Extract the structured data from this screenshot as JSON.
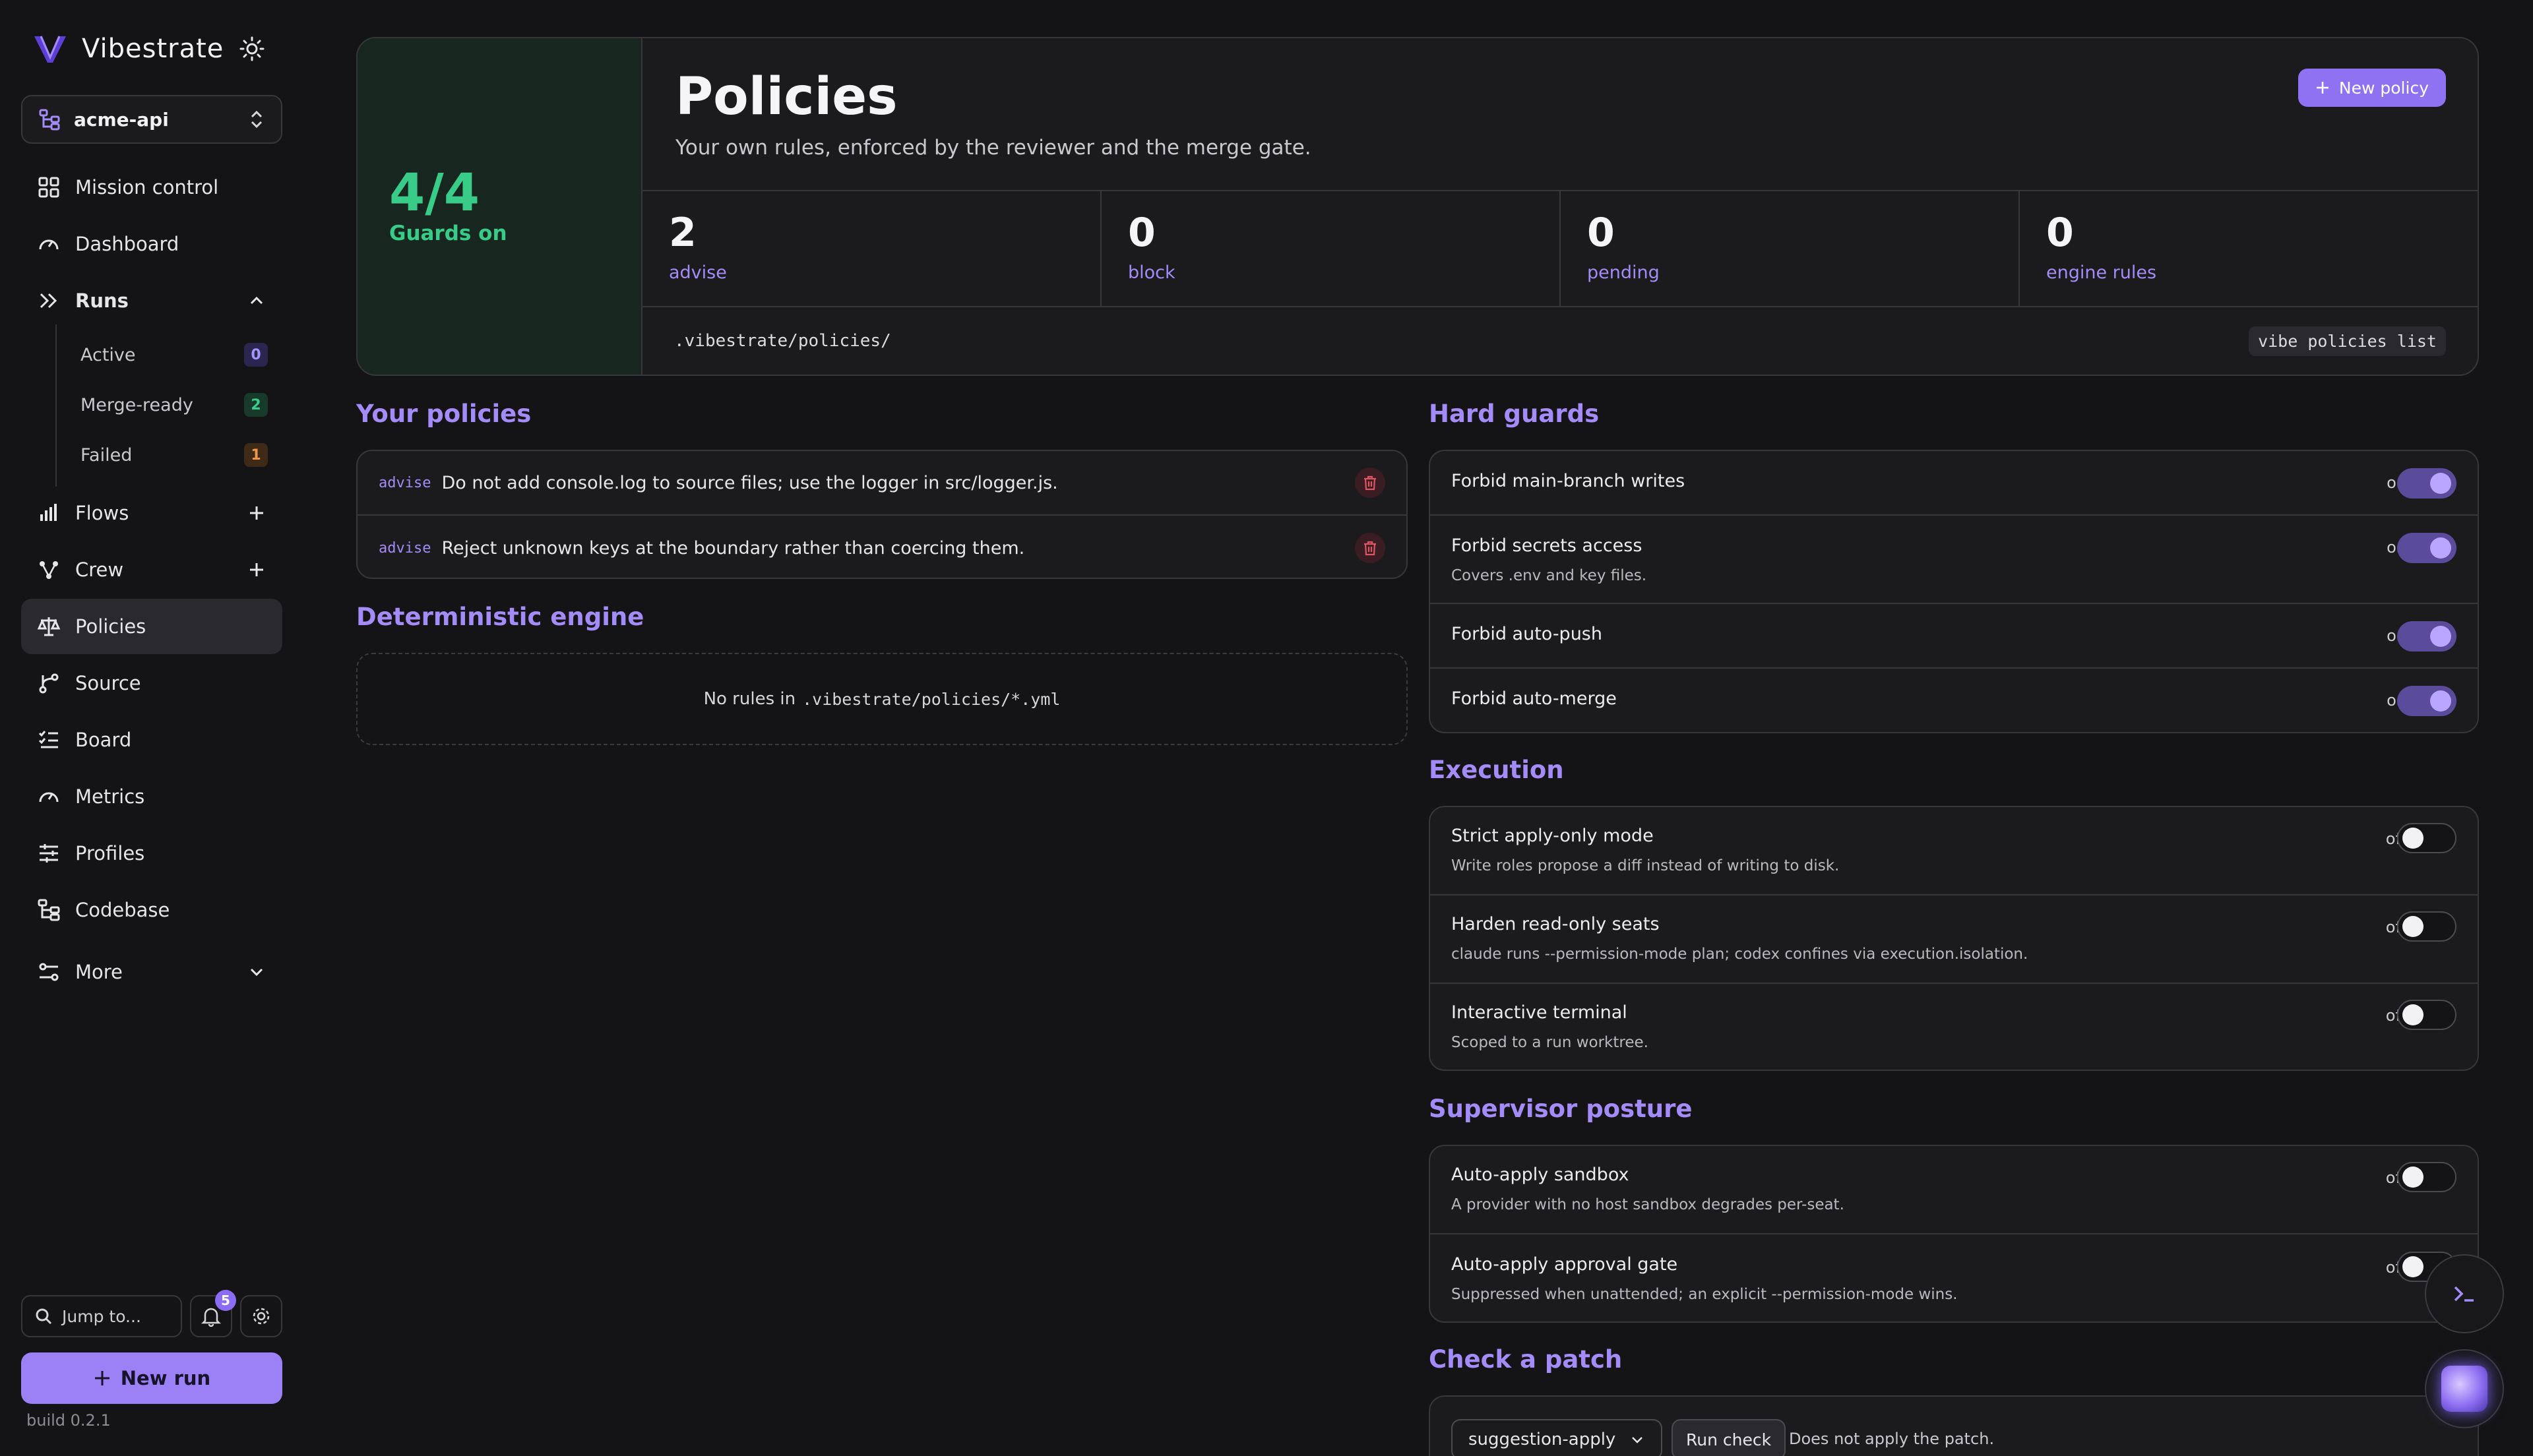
{
  "app": {
    "name": "Vibestrate",
    "build": "build 0.2.1"
  },
  "colors": {
    "accent": "#9b80f6",
    "success": "#38cc88",
    "warning": "#f0964a",
    "background": "#141416"
  },
  "repo": {
    "name": "acme-api"
  },
  "nav": {
    "mission_control": "Mission control",
    "dashboard": "Dashboard",
    "runs": "Runs",
    "runs_sub": [
      {
        "label": "Active",
        "count": "0"
      },
      {
        "label": "Merge-ready",
        "count": "2"
      },
      {
        "label": "Failed",
        "count": "1"
      }
    ],
    "flows": "Flows",
    "crew": "Crew",
    "policies": "Policies",
    "source": "Source",
    "board": "Board",
    "metrics": "Metrics",
    "profiles": "Profiles",
    "codebase": "Codebase",
    "more": "More"
  },
  "jump": {
    "placeholder": "Jump to..."
  },
  "notifications": {
    "count": "5"
  },
  "new_run": "New run",
  "header": {
    "guards_value": "4/4",
    "guards_label": "Guards on",
    "title": "Policies",
    "subtitle": "Your own rules, enforced by the reviewer and the merge gate.",
    "new_policy": "New policy",
    "stats": [
      {
        "value": "2",
        "label": "advise"
      },
      {
        "value": "0",
        "label": "block"
      },
      {
        "value": "0",
        "label": "pending"
      },
      {
        "value": "0",
        "label": "engine rules"
      }
    ],
    "path": ".vibestrate/policies/",
    "command": "vibe policies list"
  },
  "your_policies": {
    "heading": "Your policies",
    "items": [
      {
        "tag": "advise",
        "text": "Do not add console.log to source files; use the logger in src/logger.js."
      },
      {
        "tag": "advise",
        "text": "Reject unknown keys at the boundary rather than coercing them."
      }
    ]
  },
  "engine": {
    "heading": "Deterministic engine",
    "empty_prefix": "No rules in",
    "empty_path": ".vibestrate/policies/*.yml"
  },
  "hard_guards": {
    "heading": "Hard guards",
    "items": [
      {
        "title": "Forbid main-branch writes",
        "desc": "",
        "state": "on"
      },
      {
        "title": "Forbid secrets access",
        "desc": "Covers .env and key files.",
        "state": "on"
      },
      {
        "title": "Forbid auto-push",
        "desc": "",
        "state": "on"
      },
      {
        "title": "Forbid auto-merge",
        "desc": "",
        "state": "on"
      }
    ]
  },
  "execution": {
    "heading": "Execution",
    "items": [
      {
        "title": "Strict apply-only mode",
        "desc": "Write roles propose a diff instead of writing to disk.",
        "state": "off"
      },
      {
        "title": "Harden read-only seats",
        "desc": "claude runs --permission-mode plan; codex confines via execution.isolation.",
        "state": "off"
      },
      {
        "title": "Interactive terminal",
        "desc": "Scoped to a run worktree.",
        "state": "off"
      }
    ]
  },
  "supervisor": {
    "heading": "Supervisor posture",
    "items": [
      {
        "title": "Auto-apply sandbox",
        "desc": "A provider with no host sandbox degrades per-seat.",
        "state": "off"
      },
      {
        "title": "Auto-apply approval gate",
        "desc": "Suppressed when unattended; an explicit --permission-mode wins.",
        "state": "off"
      }
    ]
  },
  "check_patch": {
    "heading": "Check a patch",
    "select_value": "suggestion-apply",
    "run_label": "Run check",
    "note": "Does not apply the patch."
  }
}
